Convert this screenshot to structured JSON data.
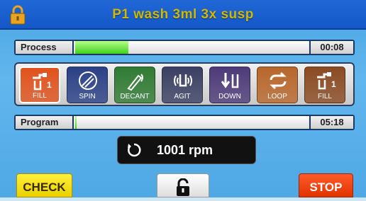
{
  "header": {
    "title": "P1 wash 3ml 3x susp",
    "lock_icon": "lock-closed-icon"
  },
  "process": {
    "label": "Process",
    "time": "00:08",
    "progress_fraction": 0.23
  },
  "program": {
    "label": "Program",
    "time": "05:18",
    "progress_fraction": 0.0
  },
  "steps": [
    {
      "label": "FILL",
      "icon": "fill-icon",
      "badge": "1",
      "color": "#e0521c",
      "active": true
    },
    {
      "label": "SPIN",
      "icon": "spin-icon",
      "color": "#2a3f86",
      "active": false
    },
    {
      "label": "DECANT",
      "icon": "decant-icon",
      "color": "#2f7a32",
      "active": false
    },
    {
      "label": "AGIT",
      "icon": "agitate-icon",
      "color": "#3a3f63",
      "active": false
    },
    {
      "label": "DOWN",
      "icon": "down-icon",
      "color": "#4c3a78",
      "active": false
    },
    {
      "label": "LOOP",
      "icon": "loop-icon",
      "color": "#b8662a",
      "active": false
    },
    {
      "label": "FILL",
      "icon": "fill-icon",
      "badge": "1",
      "color": "#8a4a22",
      "active": false
    }
  ],
  "rpm": {
    "value": "1001 rpm",
    "icon": "rotate-icon"
  },
  "buttons": {
    "check": "CHECK",
    "stop": "STOP",
    "unlock_icon": "lock-open-icon"
  },
  "colors": {
    "check": "#f4dd10",
    "stop": "#f24610",
    "title_text": "#d2b800",
    "title_bar": "#1b5fd0"
  }
}
